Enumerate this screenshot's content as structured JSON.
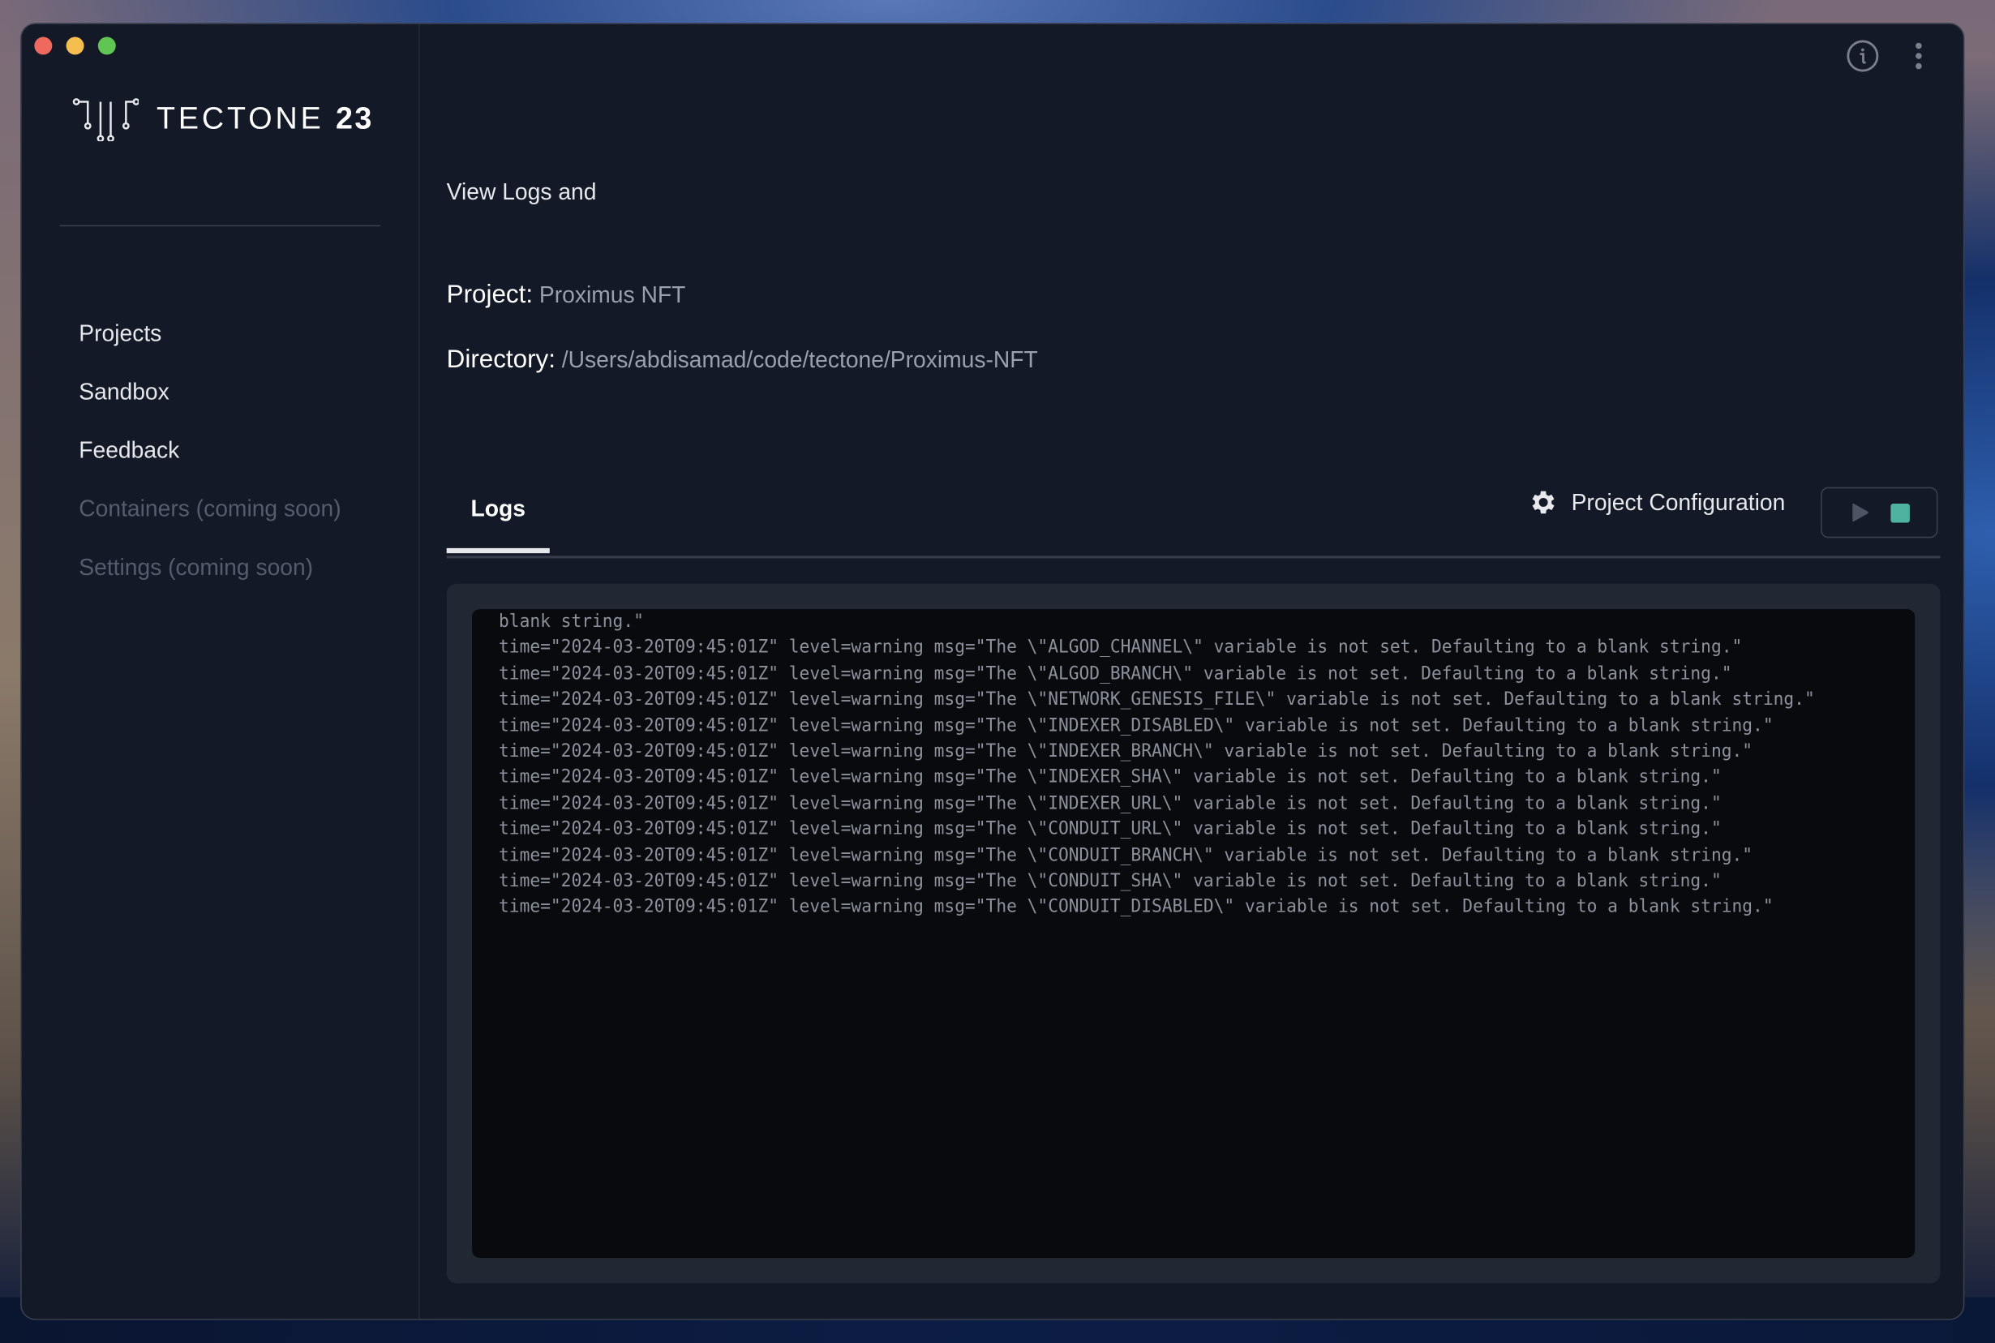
{
  "window": {
    "traffic_lights": [
      "close",
      "minimize",
      "maximize"
    ],
    "top_icons": [
      "info-icon",
      "more-vertical-icon"
    ]
  },
  "sidebar": {
    "logo": {
      "text": "TECTONE",
      "number": "23",
      "icon": "circuit-logo-icon"
    },
    "items": [
      {
        "label": "Projects",
        "enabled": true
      },
      {
        "label": "Sandbox",
        "enabled": true
      },
      {
        "label": "Feedback",
        "enabled": true
      },
      {
        "label": "Containers (coming soon)",
        "enabled": false
      },
      {
        "label": "Settings (coming soon)",
        "enabled": false
      }
    ]
  },
  "main": {
    "subtitle": "View Logs and",
    "project_label": "Project:",
    "project_value": "Proximus NFT",
    "directory_label": "Directory:",
    "directory_value": "/Users/abdisamad/code/tectone/Proximus-NFT",
    "tabs": [
      {
        "label": "Logs",
        "active": true
      }
    ],
    "config_button": {
      "label": "Project Configuration",
      "icon": "gear-icon"
    },
    "run_controls": {
      "play_icon": "play-icon",
      "stop_icon": "stop-icon",
      "stop_color": "#4fb2a1"
    }
  },
  "logs": {
    "lines": [
      "blank string.\"",
      "time=\"2024-03-20T09:45:01Z\" level=warning msg=\"The \\\"ALGOD_CHANNEL\\\" variable is not set. Defaulting to a blank string.\"",
      "time=\"2024-03-20T09:45:01Z\" level=warning msg=\"The \\\"ALGOD_BRANCH\\\" variable is not set. Defaulting to a blank string.\"",
      "time=\"2024-03-20T09:45:01Z\" level=warning msg=\"The \\\"NETWORK_GENESIS_FILE\\\" variable is not set. Defaulting to a blank string.\"",
      "time=\"2024-03-20T09:45:01Z\" level=warning msg=\"The \\\"INDEXER_DISABLED\\\" variable is not set. Defaulting to a blank string.\"",
      "time=\"2024-03-20T09:45:01Z\" level=warning msg=\"The \\\"INDEXER_BRANCH\\\" variable is not set. Defaulting to a blank string.\"",
      "time=\"2024-03-20T09:45:01Z\" level=warning msg=\"The \\\"INDEXER_SHA\\\" variable is not set. Defaulting to a blank string.\"",
      "time=\"2024-03-20T09:45:01Z\" level=warning msg=\"The \\\"INDEXER_URL\\\" variable is not set. Defaulting to a blank string.\"",
      "time=\"2024-03-20T09:45:01Z\" level=warning msg=\"The \\\"CONDUIT_URL\\\" variable is not set. Defaulting to a blank string.\"",
      "time=\"2024-03-20T09:45:01Z\" level=warning msg=\"The \\\"CONDUIT_BRANCH\\\" variable is not set. Defaulting to a blank string.\"",
      "time=\"2024-03-20T09:45:01Z\" level=warning msg=\"The \\\"CONDUIT_SHA\\\" variable is not set. Defaulting to a blank string.\"",
      "time=\"2024-03-20T09:45:01Z\" level=warning msg=\"The \\\"CONDUIT_DISABLED\\\" variable is not set. Defaulting to a blank string.\""
    ]
  },
  "colors": {
    "window_bg": "#141927",
    "log_panel_bg": "#222734",
    "log_bg": "#090a0e",
    "log_text": "#8c919c",
    "accent_stop": "#4fb2a1"
  }
}
